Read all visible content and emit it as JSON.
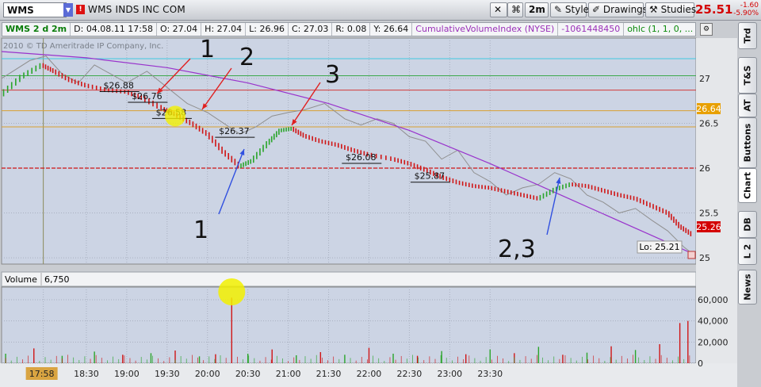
{
  "toolbar": {
    "symbol": "WMS",
    "company": "WMS INDS INC COM",
    "period_button": "2m",
    "style_button": "Style",
    "drawings_button": "Drawings",
    "studies_button": "Studies",
    "last_price": "25.51",
    "change": "-1.60",
    "change_pct": "-5.90%"
  },
  "study_header": {
    "symbol_period": "WMS 2 d 2m",
    "date": "D: 04.08.11 17:58",
    "open": "O: 27.04",
    "high": "H: 27.04",
    "low": "L: 26.96",
    "close": "C: 27.03",
    "range": "R: 0.08",
    "y": "Y: 26.64",
    "cvi_name": "CumulativeVolumeIndex (NYSE)",
    "cvi_value": "-1061448450",
    "ohlc_label": "ohlc (1, 1, 0, ..."
  },
  "side_tabs": [
    "Trd",
    "T&S",
    "AT",
    "Buttons",
    "Chart",
    "DB",
    "L 2",
    "News"
  ],
  "copyright": "2010 © TD Ameritrade IP Company, Inc.",
  "volume_header": {
    "label": "Volume",
    "value": "6,750"
  },
  "price_badge_current": "25.26",
  "price_badge_line": "26.64",
  "low_box": "Lo: 25.21",
  "time_cursor_label": "17:58",
  "colors": {
    "up": "#2aa52a",
    "down": "#d01515",
    "cvi": "#9933cc",
    "overlay": "#909090",
    "background": "#ccd4e4",
    "annotation_red": "#e02020",
    "annotation_blue": "#3050e0",
    "highlight": "#f2f000"
  },
  "chart_data": {
    "type": "line",
    "price_axis": {
      "ticks": [
        25,
        25.5,
        26,
        26.5,
        27
      ],
      "range": [
        24.93,
        27.45
      ]
    },
    "volume_axis": {
      "ticks": [
        "0",
        "20,000",
        "40,000",
        "60,000"
      ],
      "range": [
        0,
        72000
      ]
    },
    "time_labels": [
      "17:58",
      "18:30",
      "19:00",
      "19:30",
      "20:00",
      "20:30",
      "21:00",
      "21:30",
      "22:00",
      "22:30",
      "23:00",
      "23:30"
    ],
    "horizontal_lines": [
      27.03,
      26.87,
      26.64,
      26.46,
      26.0
    ],
    "price_level_labels": [
      {
        "text": "$26.88",
        "t": 18.9,
        "price": 26.88
      },
      {
        "text": "$26.76",
        "t": 19.25,
        "price": 26.76
      },
      {
        "text": "$26.58",
        "t": 19.55,
        "price": 26.58
      },
      {
        "text": "$26.37",
        "t": 20.33,
        "price": 26.37
      },
      {
        "text": "$26.08",
        "t": 21.9,
        "price": 26.08
      },
      {
        "text": "$25.87",
        "t": 22.75,
        "price": 25.87
      }
    ],
    "annotations": {
      "red_labels": [
        "1",
        "2",
        "3"
      ],
      "blue_labels": [
        "1",
        "2,3"
      ]
    },
    "price_series": [
      [
        17.45,
        26.82
      ],
      [
        17.7,
        27.02
      ],
      [
        17.95,
        27.15
      ],
      [
        18.1,
        27.08
      ],
      [
        18.3,
        26.98
      ],
      [
        18.5,
        26.92
      ],
      [
        18.75,
        26.87
      ],
      [
        19.0,
        26.85
      ],
      [
        19.2,
        26.78
      ],
      [
        19.45,
        26.66
      ],
      [
        19.6,
        26.6
      ],
      [
        19.8,
        26.5
      ],
      [
        20.0,
        26.38
      ],
      [
        20.2,
        26.18
      ],
      [
        20.4,
        26.02
      ],
      [
        20.55,
        26.08
      ],
      [
        20.75,
        26.28
      ],
      [
        20.9,
        26.42
      ],
      [
        21.05,
        26.44
      ],
      [
        21.2,
        26.36
      ],
      [
        21.4,
        26.3
      ],
      [
        21.6,
        26.26
      ],
      [
        21.8,
        26.2
      ],
      [
        22.0,
        26.15
      ],
      [
        22.3,
        26.1
      ],
      [
        22.5,
        26.05
      ],
      [
        22.7,
        25.98
      ],
      [
        22.9,
        25.9
      ],
      [
        23.1,
        25.84
      ],
      [
        23.3,
        25.8
      ],
      [
        23.5,
        25.78
      ],
      [
        23.7,
        25.74
      ],
      [
        23.9,
        25.7
      ],
      [
        24.1,
        25.66
      ],
      [
        24.3,
        25.76
      ],
      [
        24.5,
        25.82
      ],
      [
        24.7,
        25.8
      ],
      [
        24.9,
        25.75
      ],
      [
        25.1,
        25.7
      ],
      [
        25.3,
        25.66
      ],
      [
        25.5,
        25.58
      ],
      [
        25.7,
        25.5
      ],
      [
        25.85,
        25.35
      ],
      [
        26.0,
        25.26
      ]
    ],
    "cvi_series": [
      [
        17.45,
        27.3
      ],
      [
        18.5,
        27.23
      ],
      [
        19.5,
        27.12
      ],
      [
        20.5,
        26.95
      ],
      [
        21.5,
        26.72
      ],
      [
        22.5,
        26.42
      ],
      [
        23.5,
        26.05
      ],
      [
        24.5,
        25.65
      ],
      [
        25.5,
        25.25
      ],
      [
        26.0,
        25.05
      ]
    ],
    "overlay_series": [
      [
        17.45,
        27.0
      ],
      [
        17.8,
        27.2
      ],
      [
        18.0,
        27.25
      ],
      [
        18.2,
        27.05
      ],
      [
        18.4,
        26.95
      ],
      [
        18.6,
        27.15
      ],
      [
        18.8,
        27.05
      ],
      [
        19.0,
        26.95
      ],
      [
        19.25,
        27.08
      ],
      [
        19.5,
        26.9
      ],
      [
        19.75,
        26.72
      ],
      [
        20.0,
        26.62
      ],
      [
        20.2,
        26.5
      ],
      [
        20.4,
        26.38
      ],
      [
        20.6,
        26.46
      ],
      [
        20.8,
        26.58
      ],
      [
        21.0,
        26.62
      ],
      [
        21.2,
        26.65
      ],
      [
        21.45,
        26.72
      ],
      [
        21.7,
        26.55
      ],
      [
        21.9,
        26.48
      ],
      [
        22.1,
        26.55
      ],
      [
        22.3,
        26.5
      ],
      [
        22.5,
        26.35
      ],
      [
        22.7,
        26.3
      ],
      [
        22.9,
        26.1
      ],
      [
        23.1,
        26.2
      ],
      [
        23.3,
        25.95
      ],
      [
        23.5,
        25.85
      ],
      [
        23.7,
        25.7
      ],
      [
        23.9,
        25.78
      ],
      [
        24.1,
        25.82
      ],
      [
        24.3,
        25.95
      ],
      [
        24.5,
        25.88
      ],
      [
        24.7,
        25.7
      ],
      [
        24.9,
        25.62
      ],
      [
        25.1,
        25.5
      ],
      [
        25.3,
        25.55
      ],
      [
        25.5,
        25.42
      ],
      [
        25.7,
        25.3
      ],
      [
        25.9,
        25.12
      ],
      [
        26.0,
        25.05
      ]
    ],
    "volume_bars": [
      {
        "t": 17.5,
        "v": 9000
      },
      {
        "t": 17.85,
        "v": 14000
      },
      {
        "t": 18.2,
        "v": 7000
      },
      {
        "t": 18.6,
        "v": 11000
      },
      {
        "t": 18.95,
        "v": 8000
      },
      {
        "t": 19.3,
        "v": 9500
      },
      {
        "t": 19.6,
        "v": 12000
      },
      {
        "t": 19.9,
        "v": 6500
      },
      {
        "t": 20.1,
        "v": 8500
      },
      {
        "t": 20.3,
        "v": 62000
      },
      {
        "t": 20.5,
        "v": 9000
      },
      {
        "t": 20.8,
        "v": 13000
      },
      {
        "t": 21.1,
        "v": 7500
      },
      {
        "t": 21.4,
        "v": 10500
      },
      {
        "t": 21.7,
        "v": 8000
      },
      {
        "t": 22.0,
        "v": 14500
      },
      {
        "t": 22.3,
        "v": 9000
      },
      {
        "t": 22.6,
        "v": 7000
      },
      {
        "t": 22.9,
        "v": 11500
      },
      {
        "t": 23.2,
        "v": 8500
      },
      {
        "t": 23.5,
        "v": 13000
      },
      {
        "t": 23.8,
        "v": 9500
      },
      {
        "t": 24.1,
        "v": 15500
      },
      {
        "t": 24.4,
        "v": 8000
      },
      {
        "t": 24.7,
        "v": 10000
      },
      {
        "t": 25.0,
        "v": 16000
      },
      {
        "t": 25.3,
        "v": 12500
      },
      {
        "t": 25.6,
        "v": 18000
      },
      {
        "t": 25.85,
        "v": 38000
      },
      {
        "t": 25.95,
        "v": 40000
      }
    ]
  }
}
